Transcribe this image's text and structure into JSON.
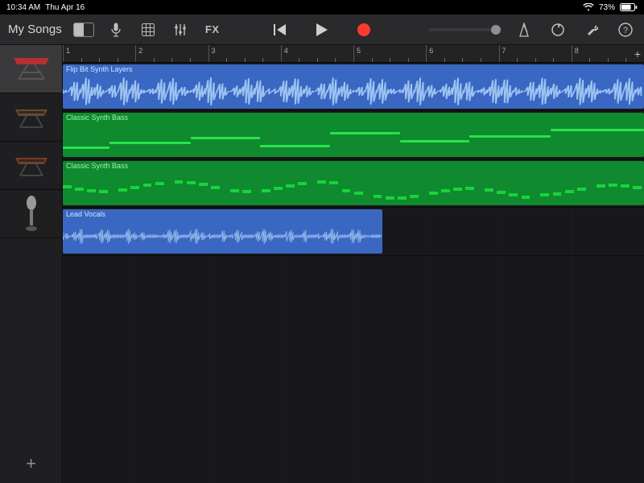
{
  "statusBar": {
    "time": "10:34 AM",
    "date": "Thu Apr 16",
    "battery": "73%"
  },
  "toolbar": {
    "backLabel": "My Songs",
    "fxLabel": "FX"
  },
  "ruler": {
    "bars": [
      "1",
      "2",
      "3",
      "4",
      "5",
      "6",
      "7",
      "8"
    ],
    "addLabel": "+"
  },
  "tracks": [
    {
      "name": "Flip Bit Synth Layers",
      "type": "audio",
      "color": "blue",
      "selected": true,
      "region": {
        "startBar": 1,
        "endBar": 9
      }
    },
    {
      "name": "Classic Synth Bass",
      "type": "midi",
      "color": "green",
      "selected": false,
      "region": {
        "startBar": 1,
        "endBar": 9
      }
    },
    {
      "name": "Classic Synth Bass",
      "type": "midi",
      "color": "green",
      "selected": false,
      "region": {
        "startBar": 1,
        "endBar": 9
      }
    },
    {
      "name": "Lead Vocals",
      "type": "audio",
      "color": "blue",
      "selected": false,
      "region": {
        "startBar": 1,
        "endBar": 5.4
      }
    }
  ],
  "sidebar": {
    "addTrackGlyph": "+"
  },
  "colors": {
    "blue": "#3a67c2",
    "green": "#0f8a2f",
    "record": "#ff3b30"
  }
}
